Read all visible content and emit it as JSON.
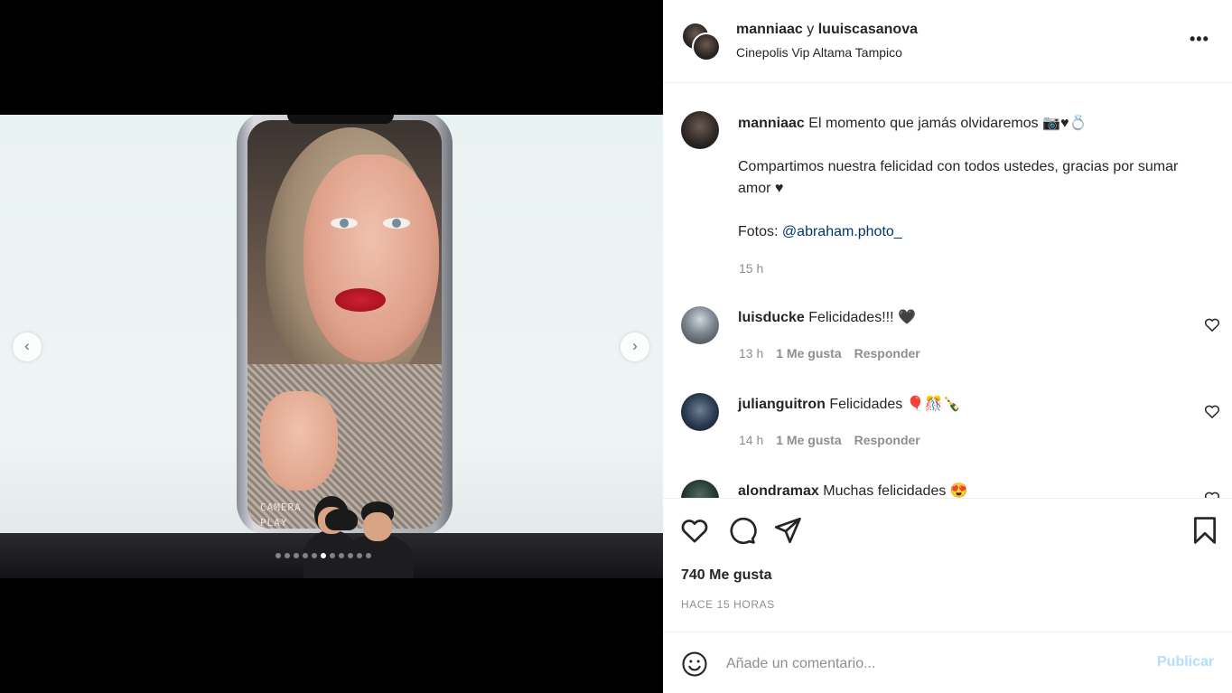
{
  "colors": {
    "link": "#00376b",
    "muted": "#8e8e8e",
    "publish_disabled": "#b2dffc",
    "text": "#262626"
  },
  "media": {
    "overlay_text": [
      "CAMERA",
      "PLAY"
    ],
    "carousel": {
      "total": 11,
      "active_index": 5
    },
    "prev_icon": "chevron-left-icon",
    "next_icon": "chevron-right-icon"
  },
  "header": {
    "user1": "manniaac",
    "connector": "y",
    "user2": "luuiscasanova",
    "location": "Cinepolis Vip Altama Tampico",
    "more_icon": "•••"
  },
  "caption": {
    "username": "manniaac",
    "line1": "El momento que jamás olvidaremos 📷♥💍",
    "line2": "Compartimos nuestra felicidad con todos ustedes, gracias por sumar amor ♥",
    "credit_prefix": "Fotos:",
    "mention": "@abraham.photo_",
    "time": "15 h"
  },
  "comments": [
    {
      "username": "luisducke",
      "text": "Felicidades!!! 🖤",
      "time": "13 h",
      "likes": "1 Me gusta",
      "reply": "Responder"
    },
    {
      "username": "julianguitron",
      "text": "Felicidades 🎈🎊🍾",
      "time": "14 h",
      "likes": "1 Me gusta",
      "reply": "Responder"
    },
    {
      "username": "alondramax",
      "text": "Muchas felicidades 😍",
      "time": "",
      "likes": "",
      "reply": ""
    }
  ],
  "actions": {
    "likes": "740 Me gusta",
    "age": "HACE 15 HORAS",
    "icons": [
      "heart-icon",
      "comment-icon",
      "share-icon",
      "bookmark-icon"
    ]
  },
  "comment_box": {
    "placeholder": "Añade un comentario...",
    "publish_label": "Publicar"
  }
}
